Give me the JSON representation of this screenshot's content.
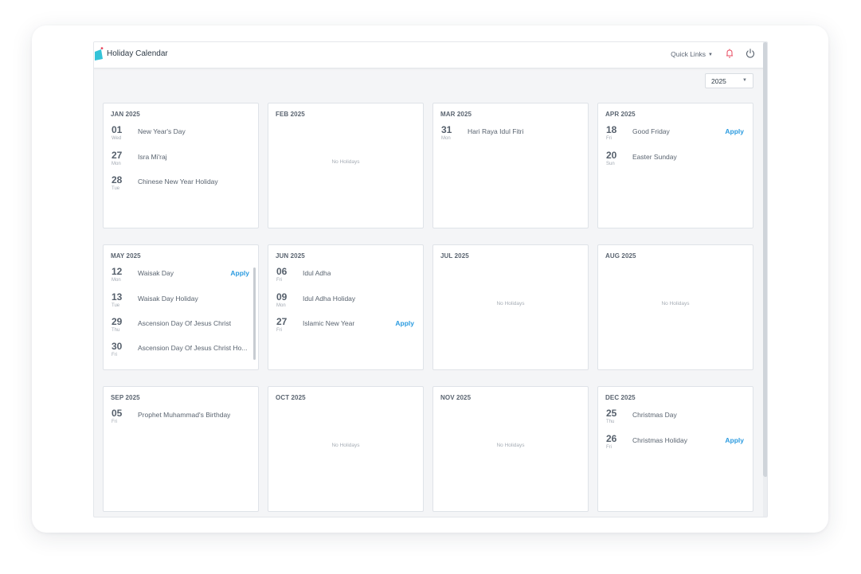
{
  "app": {
    "title": "Holiday Calendar",
    "quick_links": "Quick Links",
    "year": "2025"
  },
  "colors": {
    "accent": "#2b9be0",
    "logo": "#34c3d8",
    "logo_dot": "#e84a5f",
    "bell": "#e84a5f"
  },
  "labels": {
    "no_holidays": "No Holidays",
    "apply": "Apply"
  },
  "months": [
    {
      "title": "JAN 2025",
      "holidays": [
        {
          "day": "01",
          "weekday": "Wed",
          "name": "New Year's Day"
        },
        {
          "day": "27",
          "weekday": "Mon",
          "name": "Isra Mi'raj"
        },
        {
          "day": "28",
          "weekday": "Tue",
          "name": "Chinese New Year Holiday"
        }
      ]
    },
    {
      "title": "FEB 2025",
      "holidays": []
    },
    {
      "title": "MAR 2025",
      "holidays": [
        {
          "day": "31",
          "weekday": "Mon",
          "name": "Hari Raya Idul Fitri"
        }
      ]
    },
    {
      "title": "APR 2025",
      "holidays": [
        {
          "day": "18",
          "weekday": "Fri",
          "name": "Good Friday",
          "apply": true
        },
        {
          "day": "20",
          "weekday": "Sun",
          "name": "Easter Sunday"
        }
      ]
    },
    {
      "title": "MAY 2025",
      "scroll": true,
      "holidays": [
        {
          "day": "12",
          "weekday": "Mon",
          "name": "Waisak Day",
          "apply": true
        },
        {
          "day": "13",
          "weekday": "Tue",
          "name": "Waisak Day Holiday"
        },
        {
          "day": "29",
          "weekday": "Thu",
          "name": "Ascension Day Of Jesus Christ"
        },
        {
          "day": "30",
          "weekday": "Fri",
          "name": "Ascension Day Of Jesus Christ Ho..."
        }
      ]
    },
    {
      "title": "JUN 2025",
      "holidays": [
        {
          "day": "06",
          "weekday": "Fri",
          "name": "Idul Adha"
        },
        {
          "day": "09",
          "weekday": "Mon",
          "name": "Idul Adha Holiday"
        },
        {
          "day": "27",
          "weekday": "Fri",
          "name": "Islamic New Year",
          "apply": true
        }
      ]
    },
    {
      "title": "JUL 2025",
      "holidays": []
    },
    {
      "title": "AUG 2025",
      "holidays": []
    },
    {
      "title": "SEP 2025",
      "holidays": [
        {
          "day": "05",
          "weekday": "Fri",
          "name": "Prophet Muhammad's Birthday"
        }
      ]
    },
    {
      "title": "OCT 2025",
      "holidays": []
    },
    {
      "title": "NOV 2025",
      "holidays": []
    },
    {
      "title": "DEC 2025",
      "holidays": [
        {
          "day": "25",
          "weekday": "Thu",
          "name": "Christmas Day"
        },
        {
          "day": "26",
          "weekday": "Fri",
          "name": "Christmas Holiday",
          "apply": true
        }
      ]
    }
  ]
}
